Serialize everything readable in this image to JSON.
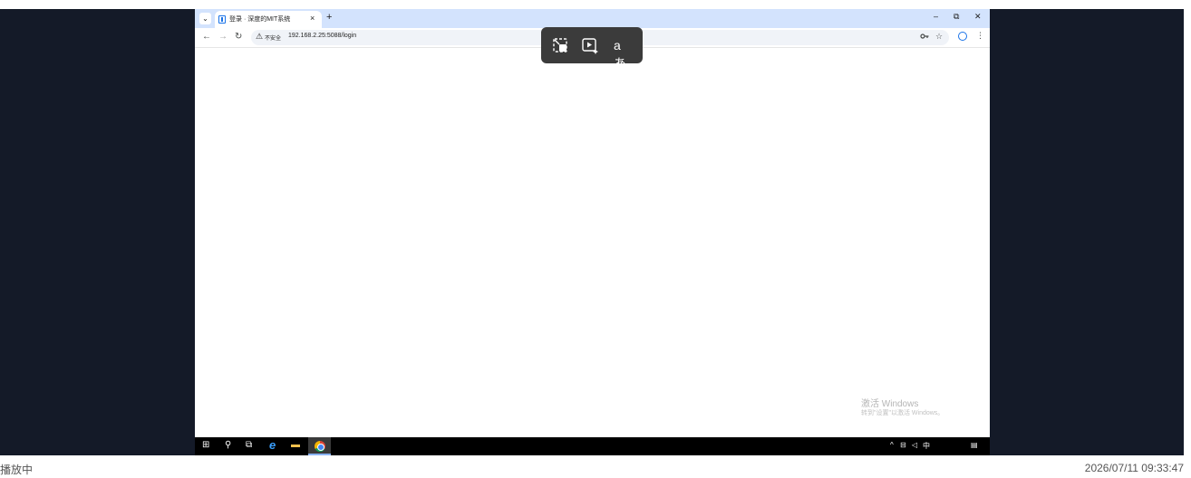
{
  "browser": {
    "tab": {
      "title": "登录 · 深度的MIT系统",
      "close_glyph": "×"
    },
    "new_tab_glyph": "+",
    "tab_search_glyph": "⌄",
    "window_controls": {
      "minimize": "–",
      "restore": "⧉",
      "close": "✕"
    },
    "nav": {
      "back": "←",
      "forward": "→",
      "reload": "↻"
    },
    "omnibox": {
      "security_icon": "⚠",
      "security_label": "不安全",
      "url": "192.168.2.25:5088/login",
      "password_icon": "key-icon",
      "star_icon": "☆"
    },
    "menu_glyph": "⋮"
  },
  "floating_toolbar": {
    "icons": [
      "exit-fullscreen-icon",
      "play-spark-icon",
      "translate-icon"
    ],
    "translate_text": "aあ"
  },
  "watermark": {
    "line1": "激活 Windows",
    "line2": "转到\"设置\"以激活 Windows。"
  },
  "taskbar": {
    "start_glyph": "⊞",
    "search_glyph": "⚲",
    "taskview_glyph": "⧉",
    "edge_glyph": "e",
    "explorer_glyph": "▬",
    "tray": {
      "chevron": "^",
      "network": "⊟",
      "volume": "◁",
      "ime": "中",
      "notification": "▤"
    }
  },
  "player": {
    "status": "播放中",
    "timestamp": "2026/07/11 09:33:47"
  }
}
